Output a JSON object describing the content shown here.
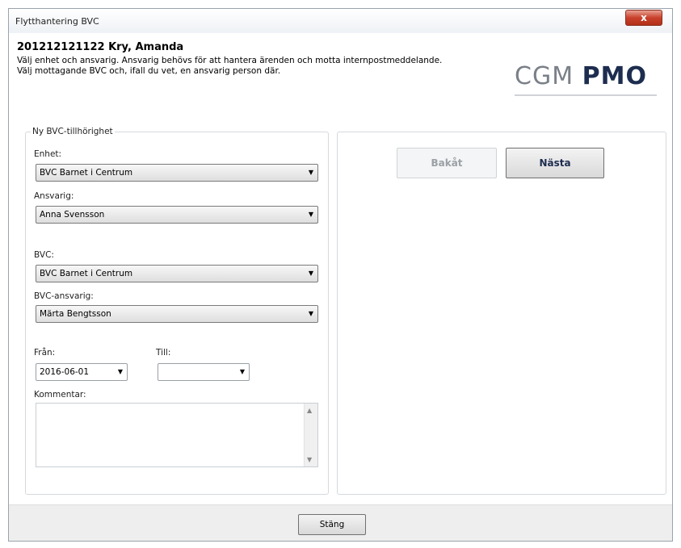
{
  "window": {
    "title": "Flytthantering BVC",
    "close_label": "x"
  },
  "header": {
    "patient": "201212121122 Kry, Amanda",
    "line1": "Välj enhet och ansvarig. Ansvarig behövs för att hantera ärenden och motta internpostmeddelande.",
    "line2": "Välj mottagande BVC och, ifall du vet, en ansvarig person där."
  },
  "logo": {
    "cgm": "CGM",
    "pmo": "PMO"
  },
  "form": {
    "legend": "Ny BVC-tillhörighet",
    "enhet_label": "Enhet:",
    "enhet_value": "BVC Barnet i Centrum",
    "ansvarig_label": "Ansvarig:",
    "ansvarig_value": "Anna Svensson",
    "bvc_label": "BVC:",
    "bvc_value": "BVC Barnet i Centrum",
    "bvc_ansvarig_label": "BVC-ansvarig:",
    "bvc_ansvarig_value": "Märta Bengtsson",
    "fran_label": "Från:",
    "fran_value": "2016-06-01",
    "till_label": "Till:",
    "till_value": "",
    "kommentar_label": "Kommentar:",
    "kommentar_value": ""
  },
  "nav": {
    "back_label": "Bakåt",
    "next_label": "Nästa"
  },
  "footer": {
    "close_label": "Stäng"
  },
  "icons": {
    "dropdown": "chevron-down-icon",
    "close": "close-icon"
  }
}
